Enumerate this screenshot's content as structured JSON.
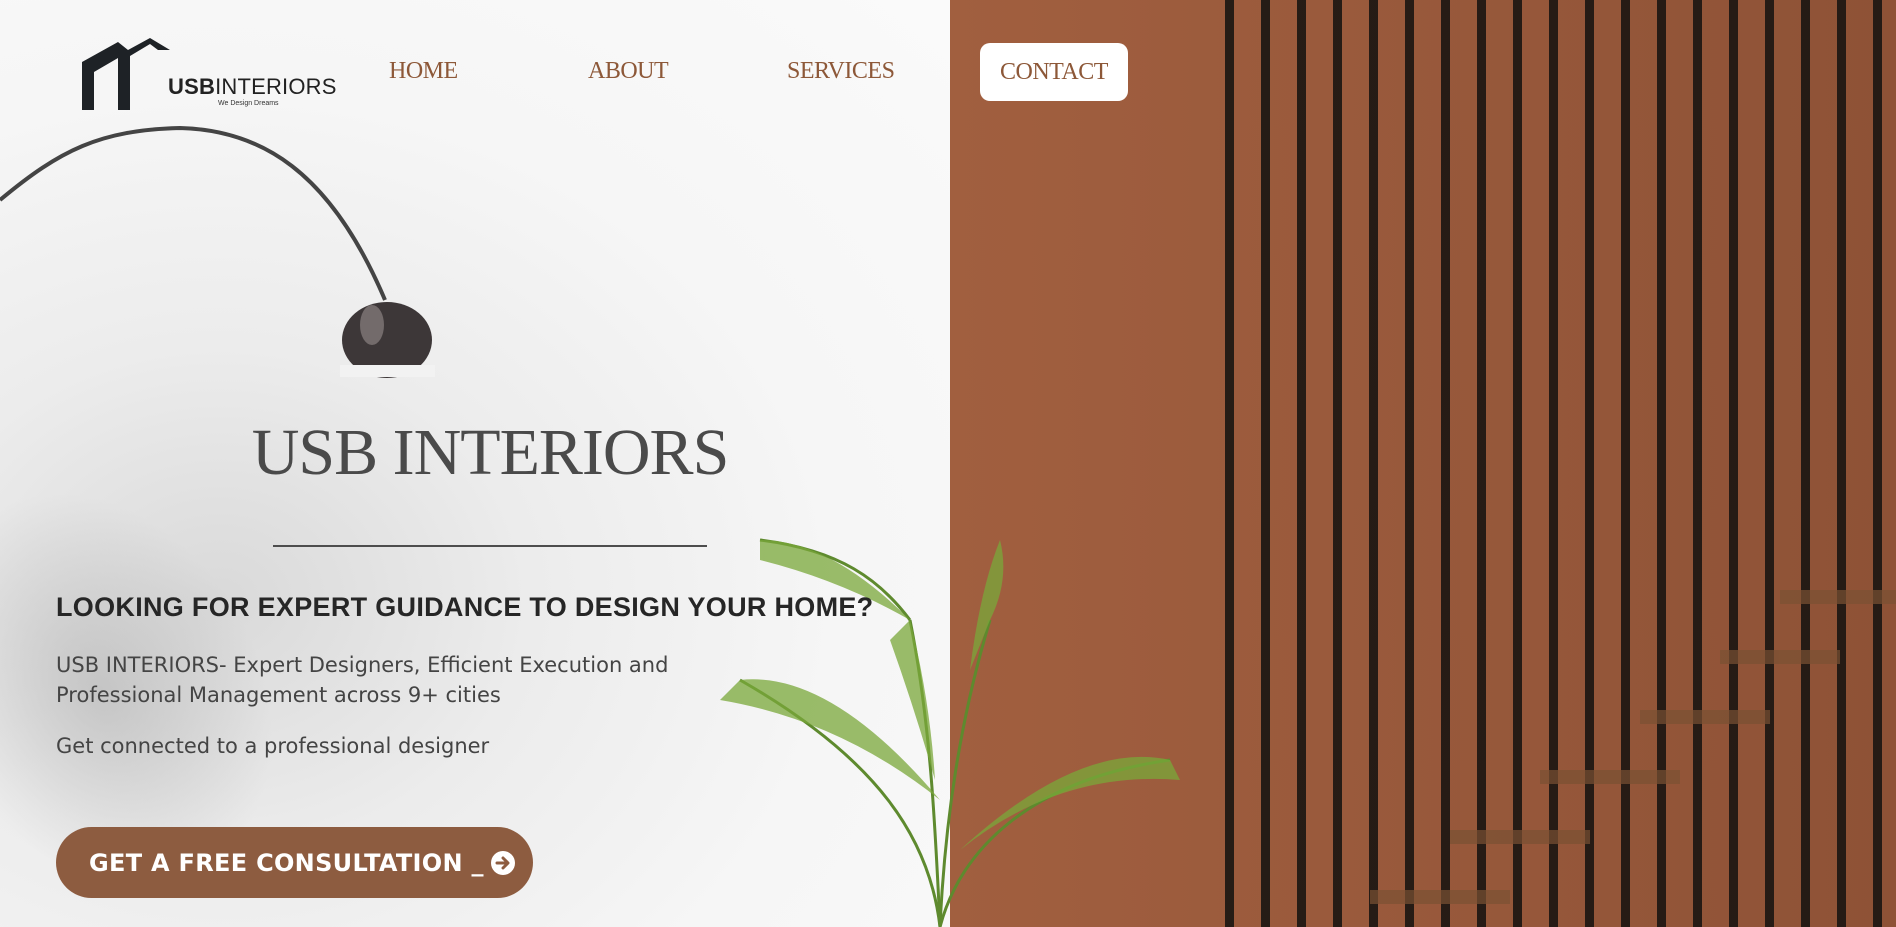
{
  "brand": {
    "logo_primary": "USB",
    "logo_secondary": "INTERIORS",
    "logo_tagline": "We Design Dreams"
  },
  "nav": {
    "items": [
      {
        "label": "HOME"
      },
      {
        "label": "ABOUT"
      },
      {
        "label": "SERVICES"
      },
      {
        "label": "CONTACT"
      }
    ]
  },
  "hero": {
    "title": "USB INTERIORS",
    "headline": "LOOKING FOR EXPERT GUIDANCE TO DESIGN YOUR HOME?",
    "description": "USB INTERIORS- Expert Designers, Efficient Execution and Professional Management across 9+ cities",
    "subtext": "Get connected to a professional designer",
    "cta_label": "GET A FREE CONSULTATION _"
  },
  "colors": {
    "accent": "#8d5c40",
    "nav_text": "#8d5838",
    "wall": "#a15f3f",
    "slats": "#1c1612"
  },
  "icons": {
    "cta": "arrow-circle-right-icon",
    "logo": "house-roof-icon"
  }
}
